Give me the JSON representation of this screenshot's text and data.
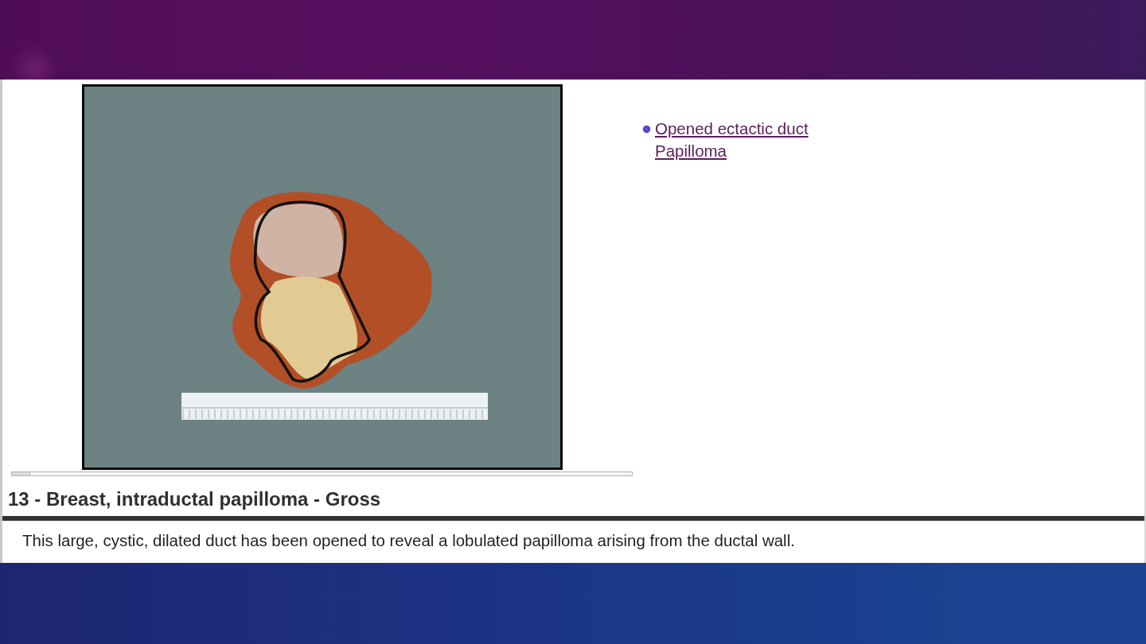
{
  "web_page": {
    "links": [
      {
        "label": "Opened ectactic duct Papilloma"
      }
    ],
    "caption": {
      "title": "13 - Breast, intraductal papilloma - Gross",
      "description": "This large, cystic, dilated duct has been opened to reveal a lobulated papilloma arising from the ductal wall."
    }
  }
}
